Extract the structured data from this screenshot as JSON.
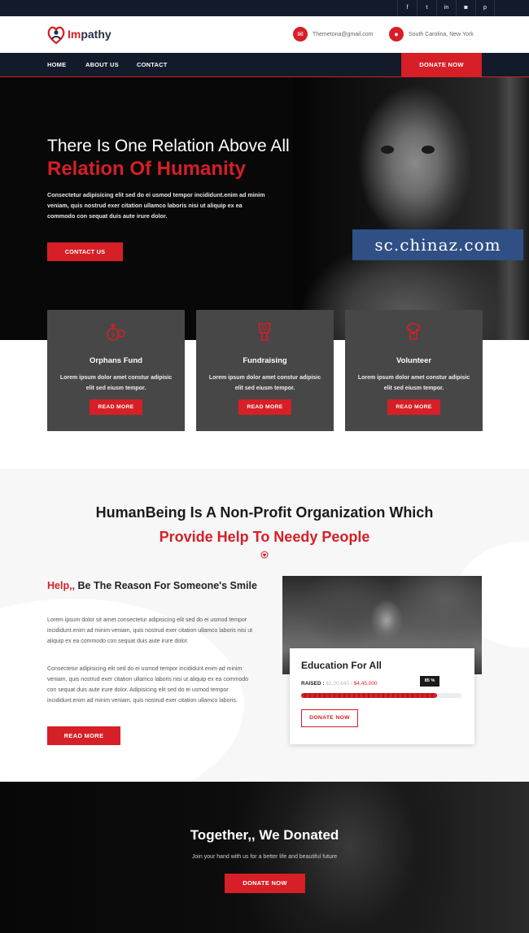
{
  "social": [
    {
      "icon": "facebook-icon",
      "glyph": "f"
    },
    {
      "icon": "twitter-icon",
      "glyph": "t"
    },
    {
      "icon": "linkedin-icon",
      "glyph": "in"
    },
    {
      "icon": "instagram-icon",
      "glyph": "◙"
    },
    {
      "icon": "pinterest-icon",
      "glyph": "p"
    }
  ],
  "header": {
    "logo_prefix": "Im",
    "logo_suffix": "pathy",
    "email": "Themetona@gmail.com",
    "location": "South Carolina, New York"
  },
  "nav": {
    "home": "HOME",
    "about": "ABOUT US",
    "contact": "CONTACT",
    "donate": "DONATE NOW"
  },
  "hero": {
    "title_line1": "There Is One Relation Above All",
    "title_line2": "Relation Of Humanity",
    "text": "Consectetur adipisicing elit sed do ei usmod tempor incididunt.enim ad minim veniam, quis nostrud exer citation ullamco laboris nisi ut aliquip ex ea commodo con sequat duis aute irure dolor.",
    "button": "CONTACT US",
    "watermark": "sc.chinaz.com"
  },
  "cards": [
    {
      "title": "Orphans Fund",
      "text": "Lorem ipsum dolor amet constur adipisic elit sed eiusm tempor.",
      "button": "READ MORE",
      "icon": "orphans-fund-icon"
    },
    {
      "title": "Fundraising",
      "text": "Lorem ipsum dolor amet constur adipisic elit sed eiusm tempor.",
      "button": "READ MORE",
      "icon": "fundraising-icon"
    },
    {
      "title": "Volunteer",
      "text": "Lorem ipsum dolor amet constur adipisic elit sed eiusm tempor.",
      "button": "READ MORE",
      "icon": "volunteer-icon"
    }
  ],
  "about": {
    "heading_line1": "HumanBeing Is A Non-Profit Organization Which",
    "heading_line2": "Provide Help To Needy People",
    "help_red": "Help,,",
    "help_rest": " Be The Reason For Someone's Smile",
    "para1": "Lorem ipsum dolor sit amet consectetur adipisicing elit sed do ei usmod tempor incididunt.enim ad minim veniam, quis nostrud exer citation ullamco laboris nisi ut aliquip ex ea commodo con sequat duis aute irure dolor.",
    "para2": "Consectetur adipisicing elit sed do ei usmod tempor incididunt.enim ad minim veniam, quis nostrud exer citation ullamco laboris nisi ut aliquip ex ea commodo con sequat duis aute irure dolor. Adipisicing elit sed do ei usmod tempor incididunt.enim ad minim veniam, quis nostrud exer citation ullamco laboris.",
    "button": "READ MORE"
  },
  "campaign": {
    "title": "Education For All",
    "raised_label": "RAISED :",
    "raised_amount": "$2,00,640",
    "separator": " / ",
    "goal": "$4,45,000",
    "progress_label": "85 %",
    "progress": 0.85,
    "button": "DONATE NOW"
  },
  "cta": {
    "title": "Together,, We Donated",
    "text": "Join your hand with us for a better life and beautiful future",
    "button": "DONATE NOW"
  },
  "colors": {
    "accent": "#d61f26",
    "dark": "#131a2a",
    "card": "#474747"
  }
}
